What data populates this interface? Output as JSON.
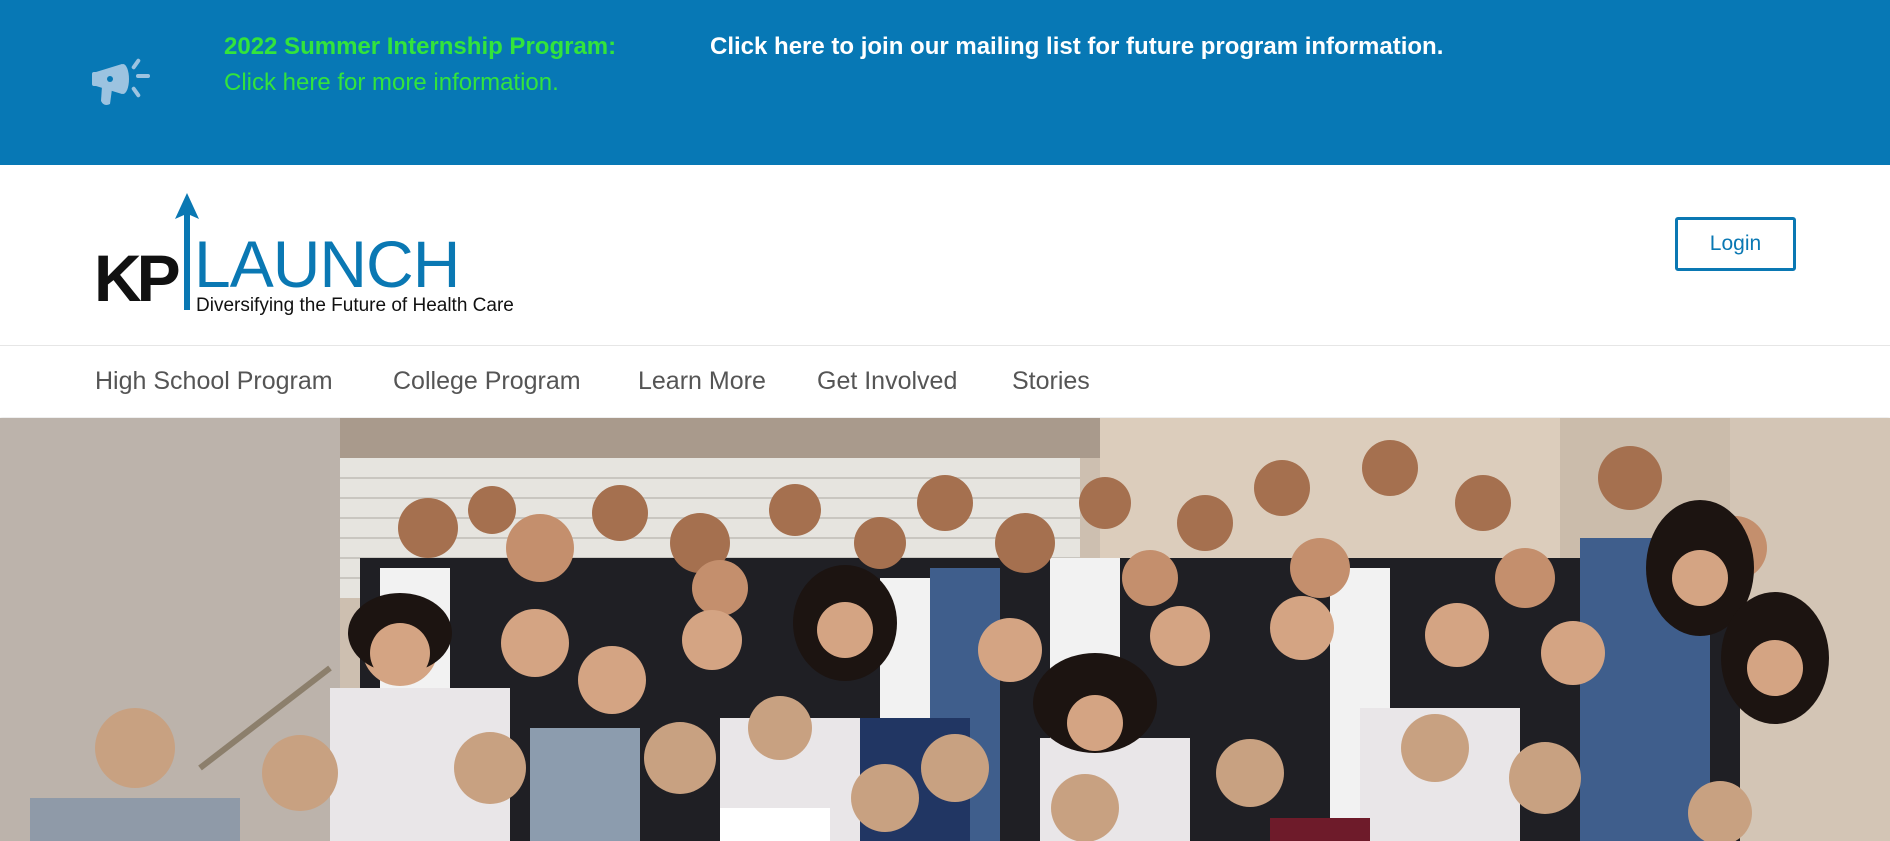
{
  "announcement": {
    "title": "2022 Summer Internship Program:",
    "more_info_link": "Click here for more information.",
    "mailing_list_link": "Click here to join our mailing list for future program information.",
    "icon": "megaphone-icon"
  },
  "header": {
    "logo": {
      "kp": "KP",
      "launch": "LAUNCH",
      "tagline": "Diversifying the Future of Health Care"
    },
    "login_label": "Login"
  },
  "nav": {
    "items": [
      {
        "label": "High School Program"
      },
      {
        "label": "College Program"
      },
      {
        "label": "Learn More"
      },
      {
        "label": "Get Involved"
      },
      {
        "label": "Stories"
      }
    ]
  },
  "colors": {
    "announcement_bg": "#0778b5",
    "promo_green": "#33e43c",
    "brand_blue": "#0a78b3"
  },
  "hero": {
    "image": "group-photo-of-program-participants"
  }
}
